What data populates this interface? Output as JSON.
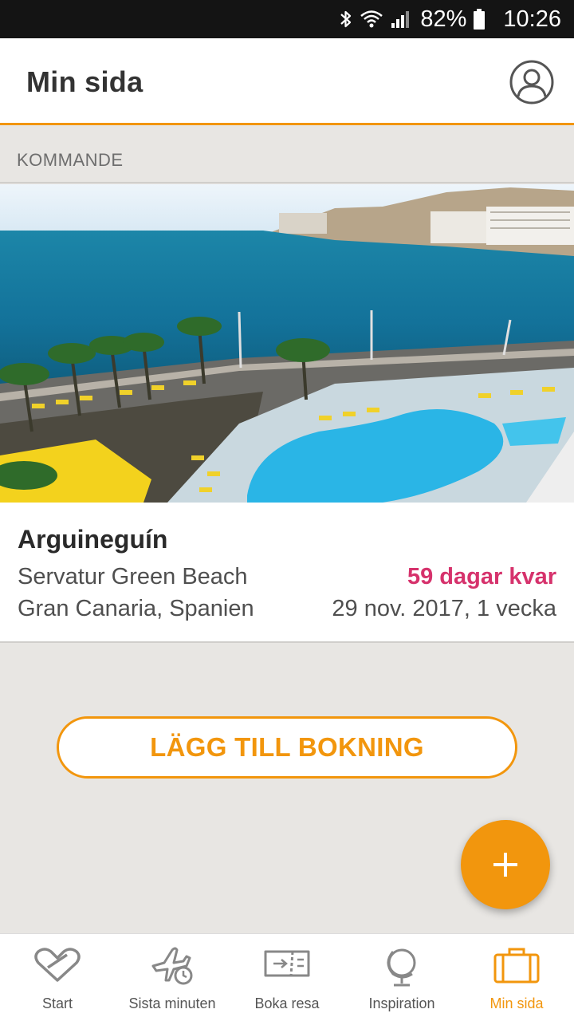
{
  "status_bar": {
    "battery": "82%",
    "time": "10:26",
    "icons": [
      "bluetooth-icon",
      "wifi-icon",
      "cell-signal-icon",
      "battery-icon"
    ]
  },
  "header": {
    "title": "Min sida",
    "profile_icon": "profile-icon"
  },
  "section": {
    "label": "KOMMANDE"
  },
  "trip": {
    "image": "resort-pool-sea-photo",
    "title": "Arguineguín",
    "hotel": "Servatur Green Beach",
    "region": "Gran Canaria, Spanien",
    "countdown": "59 dagar kvar",
    "dates": "29 nov. 2017, 1 vecka"
  },
  "actions": {
    "add_booking": "LÄGG TILL BOKNING",
    "fab_icon": "plus-icon"
  },
  "bottom_nav": {
    "items": [
      {
        "label": "Start",
        "icon": "heart-icon"
      },
      {
        "label": "Sista minuten",
        "icon": "plane-clock-icon"
      },
      {
        "label": "Boka resa",
        "icon": "ticket-icon"
      },
      {
        "label": "Inspiration",
        "icon": "globe-icon"
      },
      {
        "label": "Min sida",
        "icon": "suitcase-icon",
        "active": true
      }
    ]
  },
  "colors": {
    "accent": "#f2960d",
    "countdown": "#d6326c",
    "background": "#e8e6e3"
  }
}
